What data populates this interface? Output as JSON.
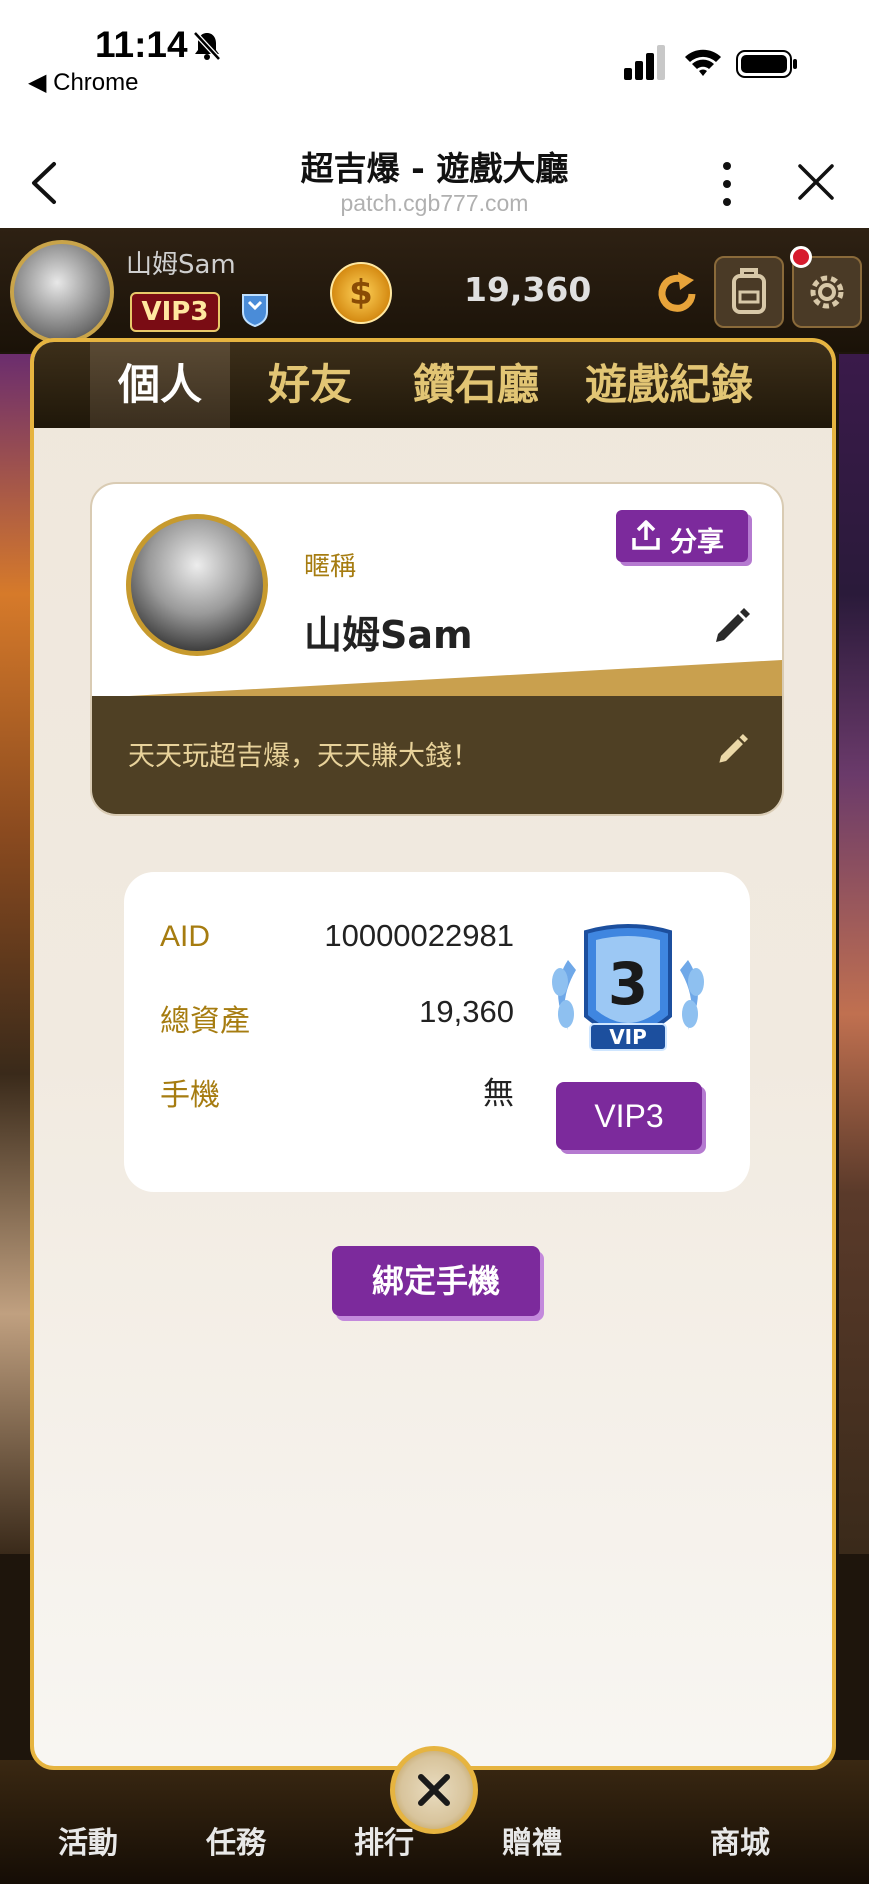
{
  "status_bar": {
    "time": "11:14",
    "back_app": "◀ Chrome"
  },
  "browser": {
    "title": "超吉爆 - 遊戲大廳",
    "url": "patch.cgb777.com"
  },
  "game_header": {
    "username": "山姆Sam",
    "vip_badge": "VIP3",
    "coin_symbol": "$",
    "balance": "19,360"
  },
  "bottom_nav": {
    "items": [
      "活動",
      "任務",
      "排行",
      "贈禮",
      "商城"
    ]
  },
  "modal": {
    "tabs": [
      {
        "label": "個人",
        "active": true
      },
      {
        "label": "好友",
        "active": false
      },
      {
        "label": "鑽石廳",
        "active": false
      },
      {
        "label": "遊戲紀錄",
        "active": false
      }
    ],
    "profile": {
      "share_label": "分享",
      "nickname_label": "暱稱",
      "nickname": "山姆Sam",
      "motto": "天天玩超吉爆，天天賺大錢！"
    },
    "info": {
      "rows": [
        {
          "label": "AID",
          "value": "10000022981"
        },
        {
          "label": "總資產",
          "value": "19,360"
        },
        {
          "label": "手機",
          "value": "無"
        }
      ],
      "vip_medal_number": "3",
      "vip_medal_text": "VIP",
      "vip_button": "VIP3"
    },
    "bind_phone_button": "綁定手機"
  },
  "colors": {
    "accent_purple": "#7c2a9c",
    "gold_border": "#e6b440",
    "label_gold": "#a67c10"
  }
}
